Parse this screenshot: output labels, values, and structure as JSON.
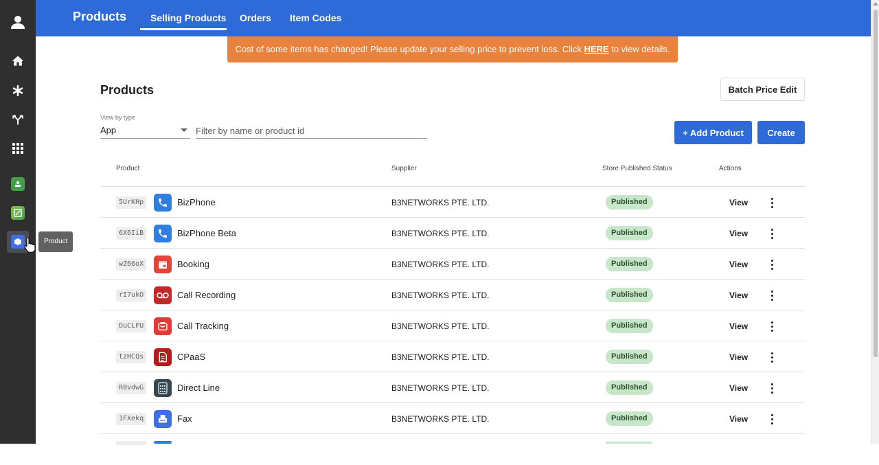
{
  "sidebar": {
    "items": [
      {
        "name": "profile",
        "icon": "user-icon"
      },
      {
        "name": "home",
        "icon": "home-icon"
      },
      {
        "name": "settings",
        "icon": "asterisk-icon"
      },
      {
        "name": "routing",
        "icon": "fork-icon"
      },
      {
        "name": "apps",
        "icon": "grid-icon"
      },
      {
        "name": "app-1",
        "icon": "green-app-icon"
      },
      {
        "name": "app-2",
        "icon": "note-app-icon"
      },
      {
        "name": "product",
        "icon": "product-icon"
      }
    ],
    "tooltip": "Product"
  },
  "header": {
    "title": "Products",
    "tabs": [
      {
        "label": "Selling Products",
        "active": true
      },
      {
        "label": "Orders",
        "active": false
      },
      {
        "label": "Item Codes",
        "active": false
      }
    ]
  },
  "alert": {
    "text_before": "Cost of some items has changed! Please update your selling price to prevent loss. Click ",
    "link": "HERE",
    "text_after": " to view details.",
    "color": "#e8823d"
  },
  "main": {
    "heading": "Products",
    "batch_button": "Batch Price Edit",
    "add_button": "+ Add Product",
    "create_button": "Create",
    "view_type_label": "View by type",
    "view_type_value": "App",
    "filter_placeholder": "Filter by name or product id"
  },
  "table": {
    "columns": [
      "Product",
      "Supplier",
      "Store Published Status",
      "Actions"
    ],
    "rows": [
      {
        "code": "5UrKHp",
        "name": "BizPhone",
        "supplier": "B3NETWORKS PTE. LTD.",
        "status": "Published",
        "action": "View",
        "icon": "phone-icon",
        "icon_color": "#2f7ee0"
      },
      {
        "code": "6X6IiB",
        "name": "BizPhone Beta",
        "supplier": "B3NETWORKS PTE. LTD.",
        "status": "Published",
        "action": "View",
        "icon": "phone-icon",
        "icon_color": "#2f7ee0"
      },
      {
        "code": "wZ66oX",
        "name": "Booking",
        "supplier": "B3NETWORKS PTE. LTD.",
        "status": "Published",
        "action": "View",
        "icon": "calendar-icon",
        "icon_color": "#e0463a"
      },
      {
        "code": "rI7ukO",
        "name": "Call Recording",
        "supplier": "B3NETWORKS PTE. LTD.",
        "status": "Published",
        "action": "View",
        "icon": "voicemail-icon",
        "icon_color": "#c62828"
      },
      {
        "code": "DuCLFU",
        "name": "Call Tracking",
        "supplier": "B3NETWORKS PTE. LTD.",
        "status": "Published",
        "action": "View",
        "icon": "tracking-icon",
        "icon_color": "#e53935"
      },
      {
        "code": "tzHCQs",
        "name": "CPaaS",
        "supplier": "B3NETWORKS PTE. LTD.",
        "status": "Published",
        "action": "View",
        "icon": "document-icon",
        "icon_color": "#b71c1c"
      },
      {
        "code": "R8vdwG",
        "name": "Direct Line",
        "supplier": "B3NETWORKS PTE. LTD.",
        "status": "Published",
        "action": "View",
        "icon": "dialpad-icon",
        "icon_color": "#37474f"
      },
      {
        "code": "1FXekq",
        "name": "Fax",
        "supplier": "B3NETWORKS PTE. LTD.",
        "status": "Published",
        "action": "View",
        "icon": "fax-icon",
        "icon_color": "#3f6fe0"
      }
    ]
  }
}
